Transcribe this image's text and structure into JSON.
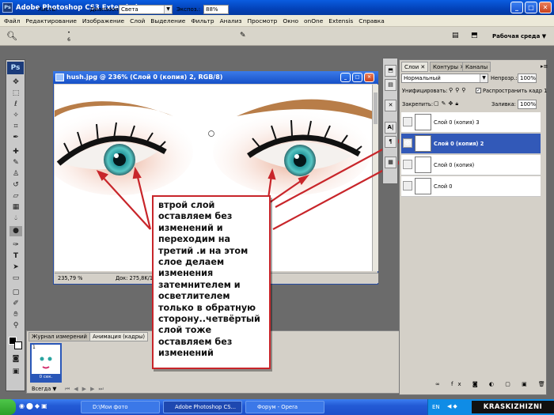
{
  "window": {
    "title": "Adobe Photoshop CS3 Extended",
    "icon": "ps-app-icon"
  },
  "menu": [
    "Файл",
    "Редактирование",
    "Изображение",
    "Слой",
    "Выделение",
    "Фильтр",
    "Анализ",
    "Просмотр",
    "Окно",
    "onOne",
    "Extensis",
    "Справка"
  ],
  "options": {
    "brush_label": "Кисть:",
    "brush_size": "6",
    "range_label": "Диапазон:",
    "range_value": "Света",
    "exposure_label": "Экспоз.:",
    "exposure_value": "88%",
    "workspace_label": "Рабочая среда"
  },
  "toolbox": {
    "logo": "Ps"
  },
  "document": {
    "title": "hush.jpg @ 236% (Слой 0 (копия) 2, RGB/8)",
    "zoom": "235,79 %",
    "doc_info": "Док: 275,8K/1,0"
  },
  "annotation": {
    "text": "втрой слой оставляем без изменений и переходим на третий .и на этом слое  делаем изменения затемнителем и осветлителем только в обратную сторону..четвёртый слой тоже оставляем без изменений"
  },
  "bottom_panel": {
    "tabs": [
      "Журнал измерений",
      "Анимация (кадры)"
    ],
    "frame_number": "1",
    "frame_delay": "0 сек.",
    "loop": "Всегда"
  },
  "layers_panel": {
    "tabs": [
      "Слои",
      "Контуры",
      "Каналы"
    ],
    "blend_mode": "Нормальный",
    "opacity_label": "Непрозр.:",
    "opacity_value": "100%",
    "unify_label": "Унифицировать:",
    "propagate_label": "Распространить кадр 1",
    "lock_label": "Закрепить:",
    "fill_label": "Заливка:",
    "fill_value": "100%",
    "layers": [
      {
        "name": "Слой 0 (копия) 3",
        "selected": false,
        "visible": false
      },
      {
        "name": "Слой 0 (копия) 2",
        "selected": true,
        "visible": true
      },
      {
        "name": "Слой 0 (копия)",
        "selected": false,
        "visible": false
      },
      {
        "name": "Слой 0",
        "selected": false,
        "visible": false
      }
    ]
  },
  "taskbar": {
    "items": [
      "D:\\Мои фото",
      "Adobe Photoshop CS...",
      "Форум - Opera"
    ],
    "lang": "EN",
    "watermark": "KRASKIZHIZNI"
  }
}
